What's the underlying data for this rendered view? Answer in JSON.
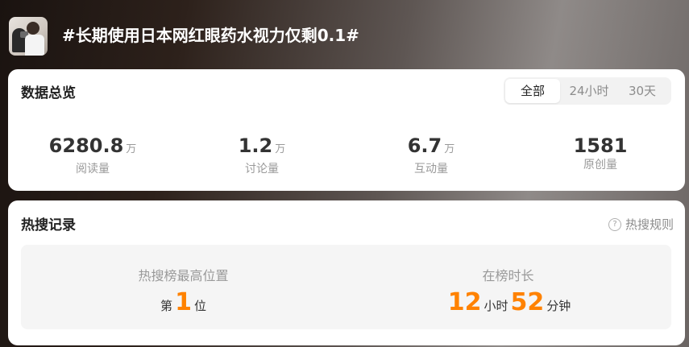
{
  "header": {
    "thumbnail_icon": "doctor-eye-exam-thumbnail",
    "title": "#长期使用日本网红眼药水视力仅剩0.1#"
  },
  "overview": {
    "title": "数据总览",
    "tabs": [
      {
        "label": "全部",
        "active": true
      },
      {
        "label": "24小时",
        "active": false
      },
      {
        "label": "30天",
        "active": false
      }
    ],
    "stats": [
      {
        "value": "6280.8",
        "unit": "万",
        "label": "阅读量"
      },
      {
        "value": "1.2",
        "unit": "万",
        "label": "讨论量"
      },
      {
        "value": "6.7",
        "unit": "万",
        "label": "互动量"
      },
      {
        "value": "1581",
        "unit": "",
        "label": "原创量"
      }
    ]
  },
  "hot_search": {
    "title": "热搜记录",
    "rules_icon": "question-circle-icon",
    "rules_icon_glyph": "?",
    "rules_label": "热搜规则",
    "highest": {
      "label": "热搜榜最高位置",
      "prefix": "第",
      "value": "1",
      "suffix": "位"
    },
    "duration": {
      "label": "在榜时长",
      "hours": "12",
      "hours_unit": "小时",
      "minutes": "52",
      "minutes_unit": "分钟"
    }
  },
  "colors": {
    "accent": "#ff8200",
    "card_bg": "#ffffff",
    "panel_bg": "#f5f5f5"
  }
}
